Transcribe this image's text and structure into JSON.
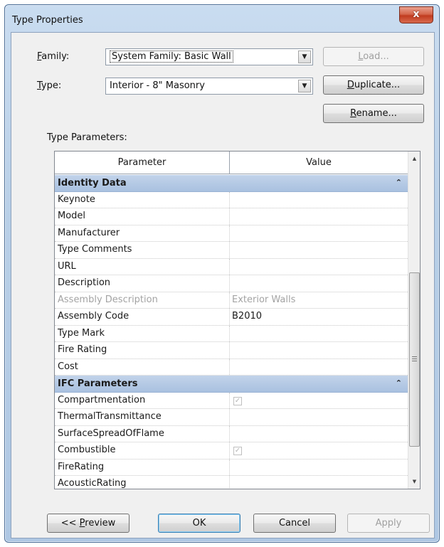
{
  "window": {
    "title": "Type Properties",
    "close_glyph": "x"
  },
  "family": {
    "label": "Family:",
    "label_key": "F",
    "label_rest": "amily:",
    "value": "System Family: Basic Wall"
  },
  "type": {
    "label_key": "T",
    "label_rest": "ype:",
    "value": "Interior - 8\" Masonry"
  },
  "buttons": {
    "load_key": "L",
    "load_rest": "oad...",
    "duplicate_key": "D",
    "duplicate_rest": "uplicate...",
    "rename_key": "R",
    "rename_rest": "ename...",
    "preview_prefix": "<< ",
    "preview_key": "P",
    "preview_rest": "review",
    "ok": "OK",
    "cancel": "Cancel",
    "apply": "Apply"
  },
  "type_parameters_label": "Type Parameters:",
  "grid": {
    "headers": {
      "parameter": "Parameter",
      "value": "Value"
    },
    "groups": [
      {
        "title": "Identity Data",
        "collapse_glyph": "⌃",
        "rows": [
          {
            "name": "Keynote",
            "value": ""
          },
          {
            "name": "Model",
            "value": ""
          },
          {
            "name": "Manufacturer",
            "value": ""
          },
          {
            "name": "Type Comments",
            "value": ""
          },
          {
            "name": "URL",
            "value": ""
          },
          {
            "name": "Description",
            "value": ""
          },
          {
            "name": "Assembly Description",
            "value": "Exterior Walls"
          },
          {
            "name": "Assembly Code",
            "value": "B2010"
          },
          {
            "name": "Type Mark",
            "value": ""
          },
          {
            "name": "Fire Rating",
            "value": ""
          },
          {
            "name": "Cost",
            "value": ""
          }
        ]
      },
      {
        "title": "IFC Parameters",
        "collapse_glyph": "⌃",
        "rows": [
          {
            "name": "Compartmentation",
            "checkbox": true,
            "check_glyph": "✓"
          },
          {
            "name": "ThermalTransmittance",
            "value": ""
          },
          {
            "name": "SurfaceSpreadOfFlame",
            "value": ""
          },
          {
            "name": "Combustible",
            "checkbox": true,
            "check_glyph": "✓"
          },
          {
            "name": "FireRating",
            "value": ""
          },
          {
            "name": "AcousticRating",
            "value": ""
          }
        ]
      }
    ]
  },
  "icons": {
    "dropdown_arrow": "▼",
    "scroll_up": "▲",
    "scroll_down": "▼"
  }
}
